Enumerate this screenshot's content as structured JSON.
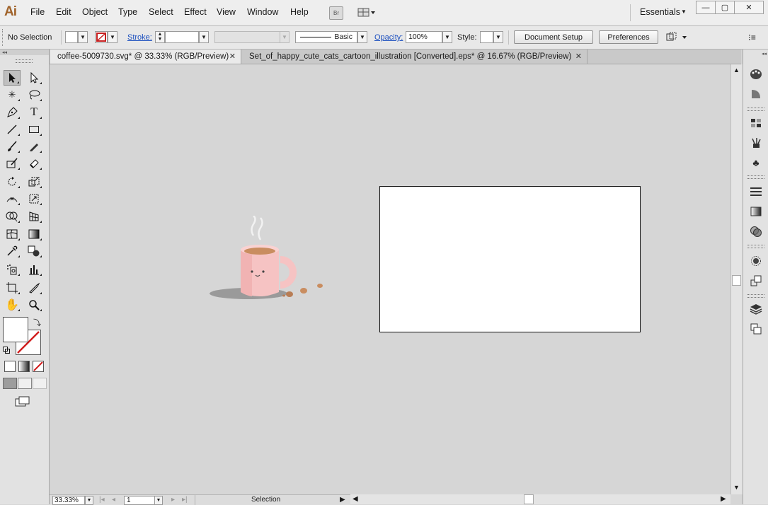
{
  "app": {
    "logo": "Ai"
  },
  "menu": {
    "items": [
      "File",
      "Edit",
      "Object",
      "Type",
      "Select",
      "Effect",
      "View",
      "Window",
      "Help"
    ],
    "bridge_label": "Br",
    "workspace": "Essentials"
  },
  "control": {
    "selection_status": "No Selection",
    "stroke_label": "Stroke:",
    "brush_label": "Basic",
    "opacity_label": "Opacity:",
    "opacity_value": "100%",
    "style_label": "Style:",
    "document_setup": "Document Setup",
    "preferences": "Preferences"
  },
  "tabs": [
    {
      "label": "coffee-5009730.svg* @ 33.33% (RGB/Preview)",
      "active": true
    },
    {
      "label": "Set_of_happy_cute_cats_cartoon_illustration [Converted].eps* @ 16.67% (RGB/Preview)",
      "active": false
    }
  ],
  "status": {
    "zoom": "33.33%",
    "artboard_number": "1",
    "current_tool": "Selection"
  },
  "colors": {
    "logo": "#a0632a",
    "mug": "#f6c3c3",
    "coffee": "#c98d60"
  }
}
